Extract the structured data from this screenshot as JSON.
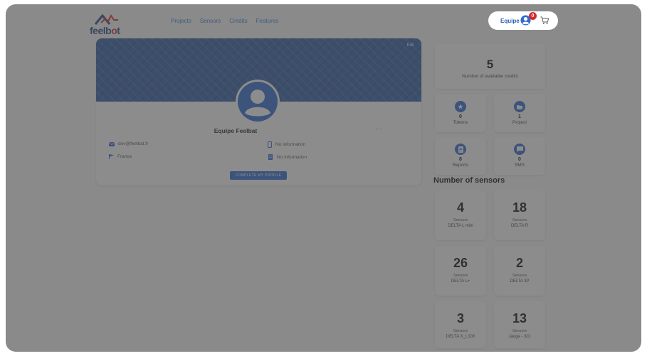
{
  "navbar": {
    "logo": {
      "text_a": "feelb",
      "text_b": "o",
      "text_c": "t"
    },
    "links": [
      "Projects",
      "Sensors",
      "Credits",
      "Features"
    ],
    "user": {
      "name": "Equipe",
      "notification_count": "0"
    }
  },
  "profile": {
    "edit_label": "Edit",
    "name": "Equipe Feelbat",
    "more": "···",
    "email": "dev@feelbat.fr",
    "country": "France",
    "phone": "No information",
    "company": "No information",
    "complete_button": "COMPLETE MY PROFILE"
  },
  "credits": {
    "value": "5",
    "label": "Number of available credits"
  },
  "stats": [
    {
      "value": "0",
      "label": "Tokens",
      "icon": "star-icon"
    },
    {
      "value": "1",
      "label": "Project",
      "icon": "folder-icon"
    },
    {
      "value": "8",
      "label": "Reports",
      "icon": "report-icon"
    },
    {
      "value": "0",
      "label": "SMS",
      "icon": "message-icon"
    }
  ],
  "sensors_title": "Number of sensors",
  "sensors": [
    {
      "value": "4",
      "sub": "Sensors",
      "model": "DELTA L mini"
    },
    {
      "value": "18",
      "sub": "Sensors",
      "model": "DELTA R"
    },
    {
      "value": "26",
      "sub": "Sensors",
      "model": "DELTA L+"
    },
    {
      "value": "2",
      "sub": "Sensors",
      "model": "DELTA 3P"
    },
    {
      "value": "3",
      "sub": "Sensors",
      "model": "DELTA X_L100"
    },
    {
      "value": "13",
      "sub": "Sensors",
      "model": "Jauge - 3CI"
    }
  ],
  "colors": {
    "brand_blue": "#2f6bd1",
    "badge_red": "#d42b2b",
    "overlay": "rgba(70,70,70,0.62)"
  }
}
